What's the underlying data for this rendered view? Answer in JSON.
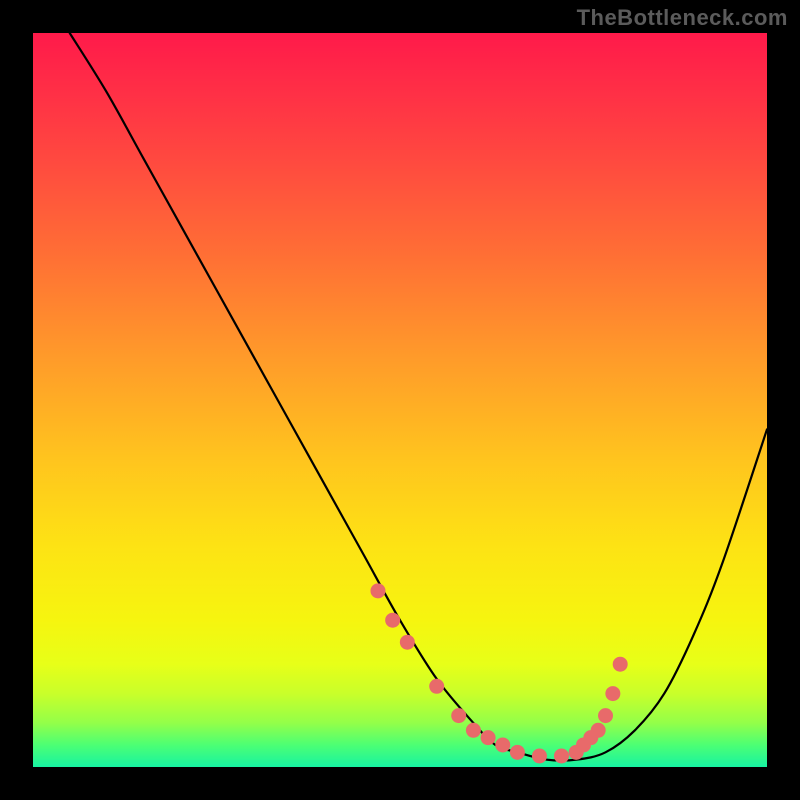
{
  "watermark": "TheBottleneck.com",
  "chart_data": {
    "type": "line",
    "title": "",
    "xlabel": "",
    "ylabel": "",
    "xlim": [
      0,
      100
    ],
    "ylim": [
      0,
      100
    ],
    "series": [
      {
        "name": "curve",
        "x": [
          5,
          10,
          15,
          20,
          25,
          30,
          35,
          40,
          45,
          50,
          55,
          60,
          63,
          66,
          70,
          74,
          78,
          82,
          86,
          90,
          94,
          100
        ],
        "y": [
          100,
          92,
          83,
          74,
          65,
          56,
          47,
          38,
          29,
          20,
          12,
          6,
          3,
          2,
          1,
          1,
          2,
          5,
          10,
          18,
          28,
          46
        ]
      }
    ],
    "markers": {
      "name": "dots",
      "color": "#e86a6a",
      "x": [
        47,
        49,
        51,
        55,
        58,
        60,
        62,
        64,
        66,
        69,
        72,
        74,
        75,
        76,
        77,
        78,
        79,
        80
      ],
      "y": [
        24,
        20,
        17,
        11,
        7,
        5,
        4,
        3,
        2,
        1.5,
        1.5,
        2,
        3,
        4,
        5,
        7,
        10,
        14
      ]
    }
  }
}
